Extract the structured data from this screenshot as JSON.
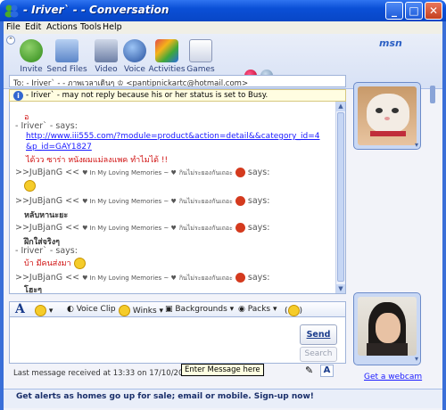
{
  "window": {
    "title": "- Iriver` - - Conversation"
  },
  "menu": [
    {
      "label": "File",
      "key": "F"
    },
    {
      "label": "Edit",
      "key": "E"
    },
    {
      "label": "Actions",
      "key": "A"
    },
    {
      "label": "Tools",
      "key": "T"
    },
    {
      "label": "Help",
      "key": "H"
    }
  ],
  "toolbar": {
    "items": [
      {
        "label": "Invite",
        "icon": "invite-icon"
      },
      {
        "label": "Send Files",
        "icon": "send-files-icon"
      },
      {
        "label": "Video",
        "icon": "video-icon"
      },
      {
        "label": "Voice",
        "icon": "voice-icon"
      },
      {
        "label": "Activities",
        "icon": "activities-icon"
      },
      {
        "label": "Games",
        "icon": "games-icon"
      }
    ],
    "brand": "msn"
  },
  "to_bar": {
    "text": "To:  - Iriver` - - ภาพเวลาเดินๆ ♔ <pantipnickartc@hotmail.com>"
  },
  "info_bar": {
    "text": "- Iriver` - may not reply because his or her status is set to Busy."
  },
  "messages": {
    "m0": "อ",
    "s1": "- Iriver` - says:",
    "link1": "http://www.iii555.com/?module=product&action=detail&&category_id=4",
    "link2": "&p_id=GAY1827",
    "m1": "ได้วว ซาร่า หนังผมแม่ลงแพค ทำไมได้ !!",
    "s2_name": ">>JuBjanG <<",
    "s2_deco": "♥ In My Loving Memories ~ ♥",
    "s2_tail": "กินไม่ระยองกันเถอะ",
    "says": "says:",
    "m3": "หลับหานะยะ",
    "m4": "ฝึกใส่จริงๆ",
    "s5": "- Iriver` - says:",
    "m5": "บ้า มีคนส่งมา",
    "m6": "โฮะๆ"
  },
  "format_bar": {
    "voice_clip": "Voice Clip",
    "winks": "Winks",
    "backgrounds": "Backgrounds",
    "packs": "Packs"
  },
  "input": {
    "send": "Send",
    "search": "Search",
    "tooltip": "Enter Message here"
  },
  "status": {
    "text": "Last message received at 13:33 on 17/10/2006."
  },
  "ad": {
    "text": "Get alerts as homes go up for sale; email or mobile. Sign-up now!"
  },
  "webcam": {
    "text": "Get a webcam"
  },
  "colors": {
    "title_blue": "#0a4fd6",
    "link_blue": "#1a1aff",
    "red_text": "#d01010"
  }
}
